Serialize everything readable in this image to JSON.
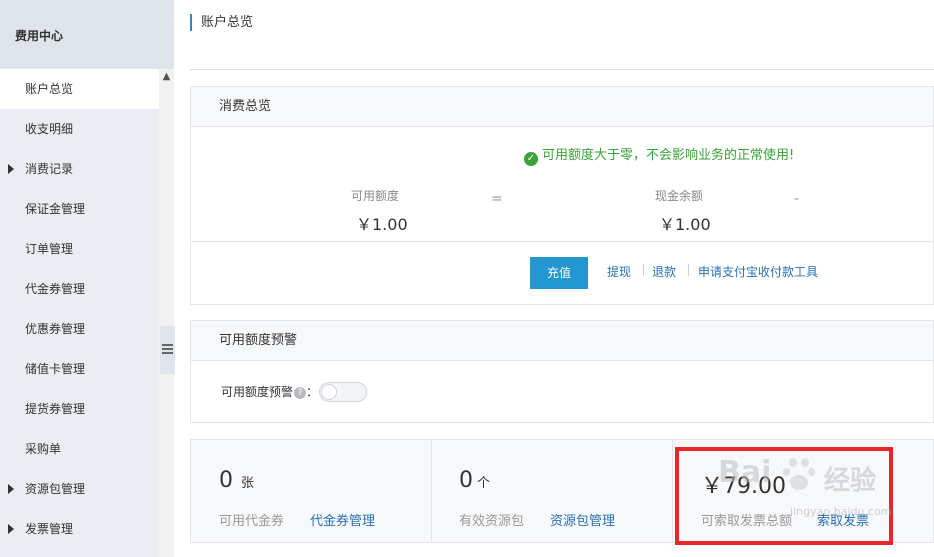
{
  "sidebar": {
    "title": "费用中心",
    "items": [
      {
        "label": "账户总览",
        "active": true,
        "expandable": false
      },
      {
        "label": "收支明细",
        "active": false,
        "expandable": false
      },
      {
        "label": "消费记录",
        "active": false,
        "expandable": true
      },
      {
        "label": "保证金管理",
        "active": false,
        "expandable": false
      },
      {
        "label": "订单管理",
        "active": false,
        "expandable": false
      },
      {
        "label": "代金券管理",
        "active": false,
        "expandable": false
      },
      {
        "label": "优惠券管理",
        "active": false,
        "expandable": false
      },
      {
        "label": "储值卡管理",
        "active": false,
        "expandable": false
      },
      {
        "label": "提货券管理",
        "active": false,
        "expandable": false
      },
      {
        "label": "采购单",
        "active": false,
        "expandable": false
      },
      {
        "label": "资源包管理",
        "active": false,
        "expandable": true
      },
      {
        "label": "发票管理",
        "active": false,
        "expandable": true
      }
    ]
  },
  "page": {
    "title": "账户总览"
  },
  "consumption": {
    "heading": "消费总览",
    "notice": "可用额度大于零，不会影响业务的正常使用!",
    "available_label": "可用额度",
    "available_value": "￥1.00",
    "equals_sign": "=",
    "cash_label": "现金余额",
    "cash_value": "￥1.00",
    "minus_sign": "-",
    "recharge_label": "充值",
    "withdraw_label": "提现",
    "refund_label": "退款",
    "alipay_tool_label": "申请支付宝收付款工具"
  },
  "alert": {
    "heading": "可用额度预警",
    "label": "可用额度预警",
    "help_glyph": "?",
    "colon": "：",
    "enabled": false
  },
  "stats": {
    "vouchers_count": "0",
    "vouchers_unit": "张",
    "vouchers_label": "可用代金券",
    "vouchers_link": "代金券管理",
    "packages_count": "0",
    "packages_unit": "个",
    "packages_label": "有效资源包",
    "packages_link": "资源包管理",
    "invoice_amount": "￥79.00",
    "invoice_label": "可索取发票总额",
    "invoice_link": "索取发票"
  },
  "watermark": {
    "text": "Bai",
    "chinese": "经验",
    "url": "jingyan.baidu.com"
  },
  "colors": {
    "accent": "#2196cf",
    "link": "#2a6fb3",
    "success": "#39a338",
    "highlight": "#e8262b"
  }
}
